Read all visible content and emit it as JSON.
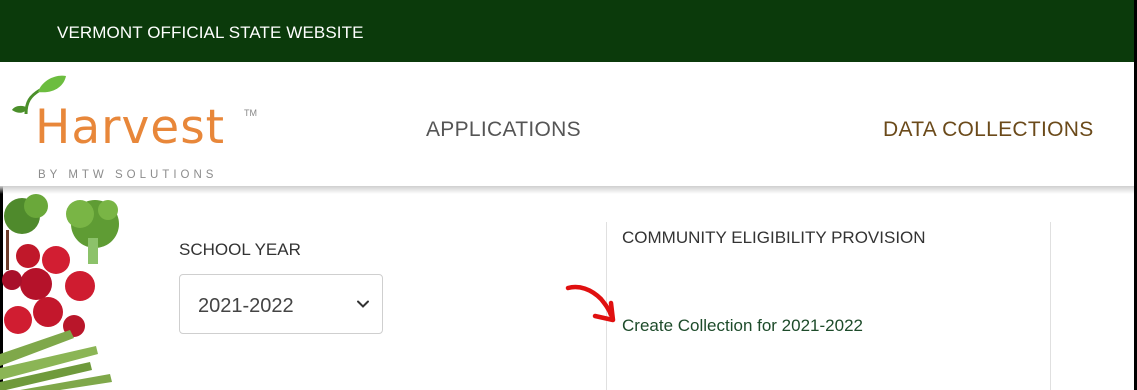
{
  "topbar": {
    "title": "VERMONT OFFICIAL STATE WEBSITE"
  },
  "header": {
    "logo": {
      "wordmark": "Harvest",
      "trademark": "TM",
      "byline": "BY MTW SOLUTIONS"
    },
    "nav": {
      "applications": "APPLICATIONS",
      "data_collections": "DATA COLLECTIONS"
    }
  },
  "filters": {
    "school_year_label": "SCHOOL YEAR",
    "school_year_value": "2021-2022"
  },
  "collection": {
    "title": "COMMUNITY ELIGIBILITY PROVISION",
    "create_link": "Create Collection for 2021-2022"
  },
  "colors": {
    "topbar": "#0b3a0b",
    "logo_orange": "#e8873a",
    "logo_leaf": "#6cbd3f",
    "nav_active": "#6b4a1a",
    "link": "#1d4b2a",
    "annotation_arrow": "#e01010"
  },
  "icons": {
    "dropdown": "chevron-down-icon",
    "annotation": "red-arrow-icon"
  }
}
